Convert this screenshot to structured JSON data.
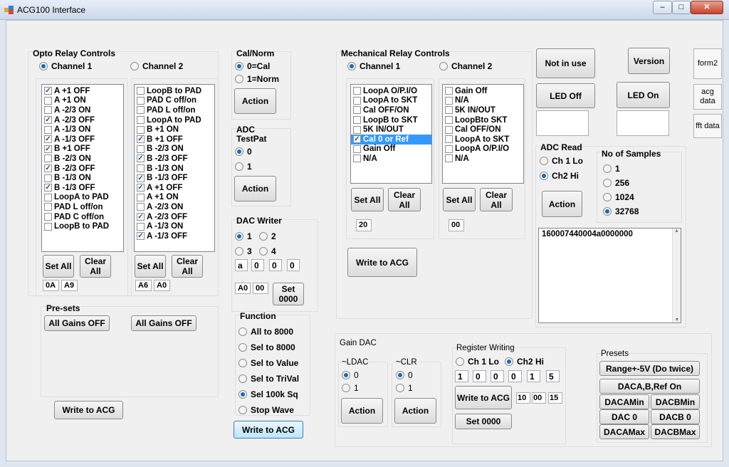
{
  "window": {
    "title": "ACG100 Interface",
    "min": "–",
    "max": "□",
    "close": "✕"
  },
  "opto": {
    "title": "Opto Relay Controls",
    "ch1": "Channel 1",
    "ch2": "Channel 2",
    "list1": [
      {
        "label": "A +1 OFF",
        "checked": true
      },
      {
        "label": "A +1 ON",
        "checked": false
      },
      {
        "label": "A -2/3 ON",
        "checked": false
      },
      {
        "label": "A -2/3 OFF",
        "checked": true
      },
      {
        "label": "A -1/3 ON",
        "checked": false
      },
      {
        "label": "A -1/3 OFF",
        "checked": true
      },
      {
        "label": "B +1 OFF",
        "checked": true
      },
      {
        "label": "B -2/3 ON",
        "checked": false
      },
      {
        "label": "B -2/3 OFF",
        "checked": true
      },
      {
        "label": "B -1/3 ON",
        "checked": false
      },
      {
        "label": "B -1/3 OFF",
        "checked": true
      },
      {
        "label": "LoopA to PAD",
        "checked": false
      },
      {
        "label": "PAD L off/on",
        "checked": false
      },
      {
        "label": "PAD C off/on",
        "checked": false
      },
      {
        "label": "LoopB to PAD",
        "checked": false
      }
    ],
    "list2": [
      {
        "label": "LoopB to PAD",
        "checked": false
      },
      {
        "label": "PAD C off/on",
        "checked": false
      },
      {
        "label": "PAD L off/on",
        "checked": false
      },
      {
        "label": "LoopA to PAD",
        "checked": false
      },
      {
        "label": "B +1 ON",
        "checked": false
      },
      {
        "label": "B +1 OFF",
        "checked": true
      },
      {
        "label": "B -2/3 ON",
        "checked": false
      },
      {
        "label": "B -2/3 OFF",
        "checked": true
      },
      {
        "label": "B -1/3 ON",
        "checked": false
      },
      {
        "label": "B -1/3 OFF",
        "checked": true
      },
      {
        "label": "A +1 OFF",
        "checked": true
      },
      {
        "label": "A +1 ON",
        "checked": false
      },
      {
        "label": "A -2/3 ON",
        "checked": false
      },
      {
        "label": "A -2/3 OFF",
        "checked": true
      },
      {
        "label": "A -1/3 ON",
        "checked": false
      },
      {
        "label": "A -1/3 OFF",
        "checked": true
      }
    ],
    "set_all": "Set All",
    "clear_all": "Clear All",
    "hex1a": "0A",
    "hex1b": "A9",
    "hex2a": "A6",
    "hex2b": "A0",
    "presets": "Pre-sets",
    "all_gains_off_1": "All Gains OFF",
    "all_gains_off_2": "All Gains OFF",
    "write": "Write to ACG"
  },
  "calnorm": {
    "title": "Cal/Norm",
    "opt0": "0=Cal",
    "opt1": "1=Norm",
    "action": "Action"
  },
  "adctest": {
    "title1": "ADC",
    "title2": "TestPat",
    "opt0": "0",
    "opt1": "1",
    "action": "Action"
  },
  "dacwriter": {
    "title": "DAC Writer",
    "r1": "1",
    "r2": "2",
    "r3": "3",
    "r4": "4",
    "v0": "a",
    "v1": "0",
    "v2": "0",
    "v3": "0",
    "out0": "A0",
    "out1": "00",
    "set": "Set 0000"
  },
  "function": {
    "title": "Function",
    "items": [
      "All to 8000",
      "Sel to 8000",
      "Sel to Value",
      "Sel to TriVal",
      "Sel 100k Sq",
      "Stop Wave"
    ],
    "selected": 4,
    "write": "Write to ACG"
  },
  "mech": {
    "title": "Mechanical Relay Controls",
    "ch1": "Channel 1",
    "ch2": "Channel 2",
    "list1": [
      {
        "label": "LoopA O/P.I/O",
        "checked": false
      },
      {
        "label": "LoopA to SKT",
        "checked": false
      },
      {
        "label": "Cal OFF/ON",
        "checked": false
      },
      {
        "label": "LoopB to SKT",
        "checked": false
      },
      {
        "label": "5K IN/OUT",
        "checked": false
      },
      {
        "label": "Cal 0 or Ref",
        "checked": true
      },
      {
        "label": "Gain Off",
        "checked": false
      },
      {
        "label": "N/A",
        "checked": false
      }
    ],
    "list2": [
      {
        "label": "Gain Off",
        "checked": false
      },
      {
        "label": "N/A",
        "checked": false
      },
      {
        "label": "5K IN/OUT",
        "checked": false
      },
      {
        "label": "LoopBto SKT",
        "checked": false
      },
      {
        "label": "Cal OFF/ON",
        "checked": false
      },
      {
        "label": "LoopA to SKT",
        "checked": false
      },
      {
        "label": "LoopA O/P.I/O",
        "checked": false
      },
      {
        "label": "N/A",
        "checked": false
      }
    ],
    "set_all": "Set All",
    "clear_all": "Clear All",
    "hex1": "20",
    "hex2": "00",
    "write": "Write to ACG"
  },
  "top": {
    "not_in_use": "Not in use",
    "version": "Version",
    "led_off": "LED Off",
    "led_on": "LED On",
    "form2": "form2",
    "acg_data": "acg data",
    "fft_data": "fft data"
  },
  "adcread": {
    "title": "ADC Read",
    "ch1": "Ch 1 Lo",
    "ch2": "Ch2 Hi",
    "action": "Action",
    "samples_title": "No of Samples",
    "samples": [
      "1",
      "256",
      "1024",
      "32768"
    ],
    "samples_selected": 3,
    "output": "160007440004a0000000"
  },
  "gaindac": {
    "title": "Gain DAC",
    "ldac": "~LDAC",
    "clr": "~CLR",
    "opt0": "0",
    "opt1": "1",
    "action": "Action"
  },
  "regwrite": {
    "title": "Register Writing",
    "ch1": "Ch 1 Lo",
    "ch2": "Ch2 Hi",
    "vals": [
      "1",
      "0",
      "0",
      "0",
      "1",
      "5"
    ],
    "write": "Write to ACG",
    "out": [
      "10",
      "00",
      "15"
    ],
    "set": "Set 0000"
  },
  "presets": {
    "title": "Presets",
    "range": "Range+-5V (Do twice)",
    "dacab": "DACA,B,Ref On",
    "dacamin": "DACAMin",
    "dacbmin": "DACBMin",
    "daca0": "DAC 0",
    "dacb0": "DACB 0",
    "dacamax": "DACAMax",
    "dacbmax": "DACBMax"
  }
}
